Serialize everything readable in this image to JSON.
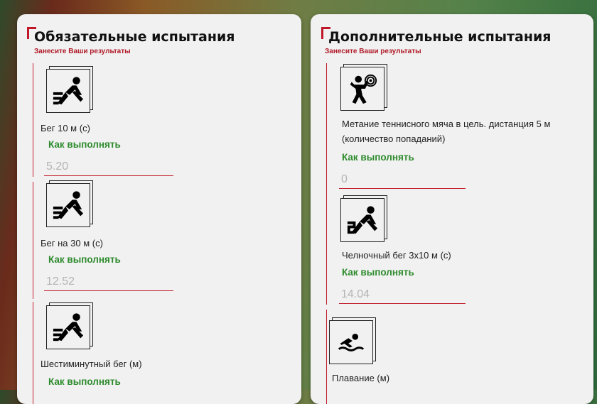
{
  "required": {
    "title": "Обязательные испытания",
    "subtitle": "Занесите Ваши результаты",
    "tests": [
      {
        "name": "Бег 10 м (с)",
        "how_label": "Как выполнять",
        "placeholder": "5.20",
        "icon": "running-icon"
      },
      {
        "name": "Бег на 30 м (с)",
        "how_label": "Как выполнять",
        "placeholder": "12.52",
        "icon": "running-icon"
      },
      {
        "name": "Шестиминутный бег (м)",
        "how_label": "Как выполнять",
        "placeholder": "",
        "icon": "running-icon"
      }
    ]
  },
  "additional": {
    "title": "Дополнительные испытания",
    "subtitle": "Занесите Ваши результаты",
    "tests": [
      {
        "name": "Метание теннисного мяча в цель. дистанция 5 м (количество попаданий)",
        "how_label": "Как выполнять",
        "placeholder": "0",
        "icon": "ball-throw-icon"
      },
      {
        "name": "Челночный бег 3х10 м (с)",
        "how_label": "Как выполнять",
        "placeholder": "14.04",
        "icon": "shuttle-run-icon"
      },
      {
        "name": "Плавание (м)",
        "how_label": "",
        "placeholder": "",
        "icon": "swimming-icon"
      }
    ]
  },
  "colors": {
    "accent_red": "#c4202f",
    "link_green": "#2e8b2e",
    "card_bg": "#f1f1f1"
  }
}
